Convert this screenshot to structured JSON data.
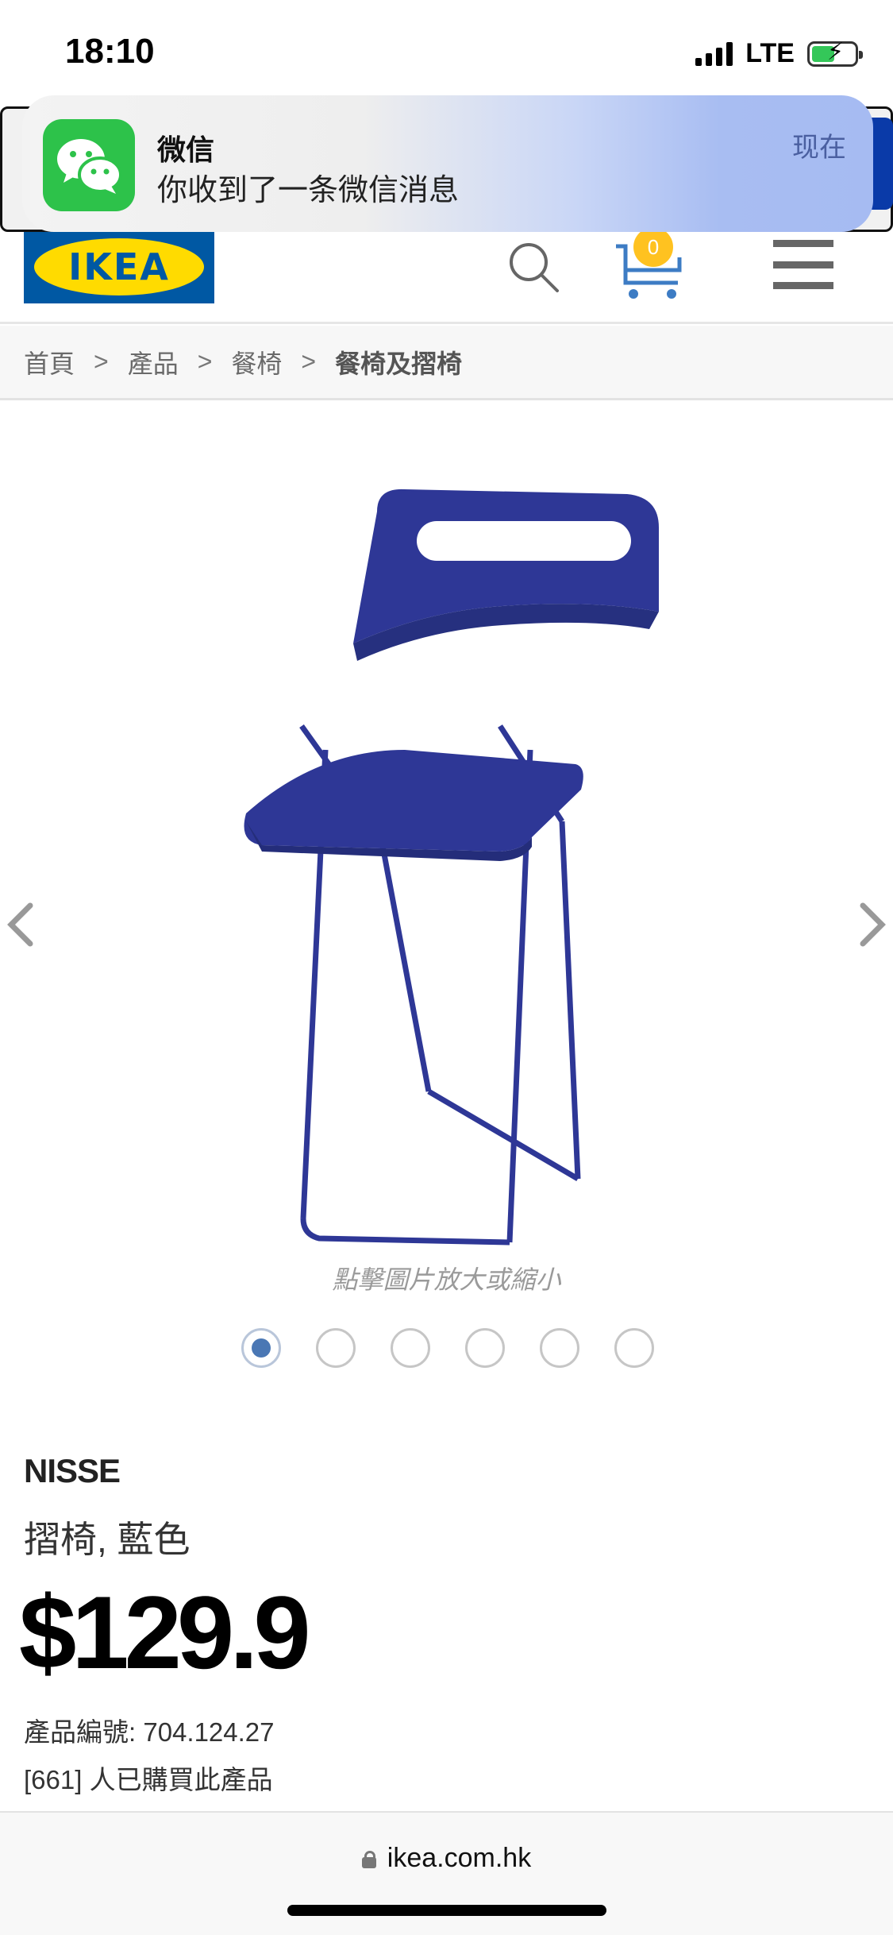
{
  "status_bar": {
    "time": "18:10",
    "network": "LTE",
    "battery_charging": true
  },
  "notification": {
    "app_name": "微信",
    "message": "你收到了一条微信消息",
    "time": "现在",
    "icon": "wechat-icon"
  },
  "header": {
    "logo_text": "IKEA",
    "cart_count": "0",
    "icons": [
      "search-icon",
      "cart-icon",
      "menu-icon"
    ]
  },
  "breadcrumb": {
    "items": [
      "首頁",
      "產品",
      "餐椅"
    ],
    "current": "餐椅及摺椅",
    "separator": ">"
  },
  "gallery": {
    "zoom_hint": "點擊圖片放大或縮小",
    "image_count": 6,
    "active_index": 0
  },
  "product": {
    "name": "NISSE",
    "description": "摺椅, 藍色",
    "price": "$129.9",
    "number_label": "產品編號: 704.124.27",
    "buyers_label": "[661] 人已購買此產品"
  },
  "browser": {
    "url": "ikea.com.hk"
  },
  "colors": {
    "ikea_blue": "#0058a3",
    "ikea_yellow": "#ffdb00",
    "chair_blue": "#2e3796",
    "wechat_green": "#2dc24a",
    "active_dot": "#4a77b4"
  }
}
